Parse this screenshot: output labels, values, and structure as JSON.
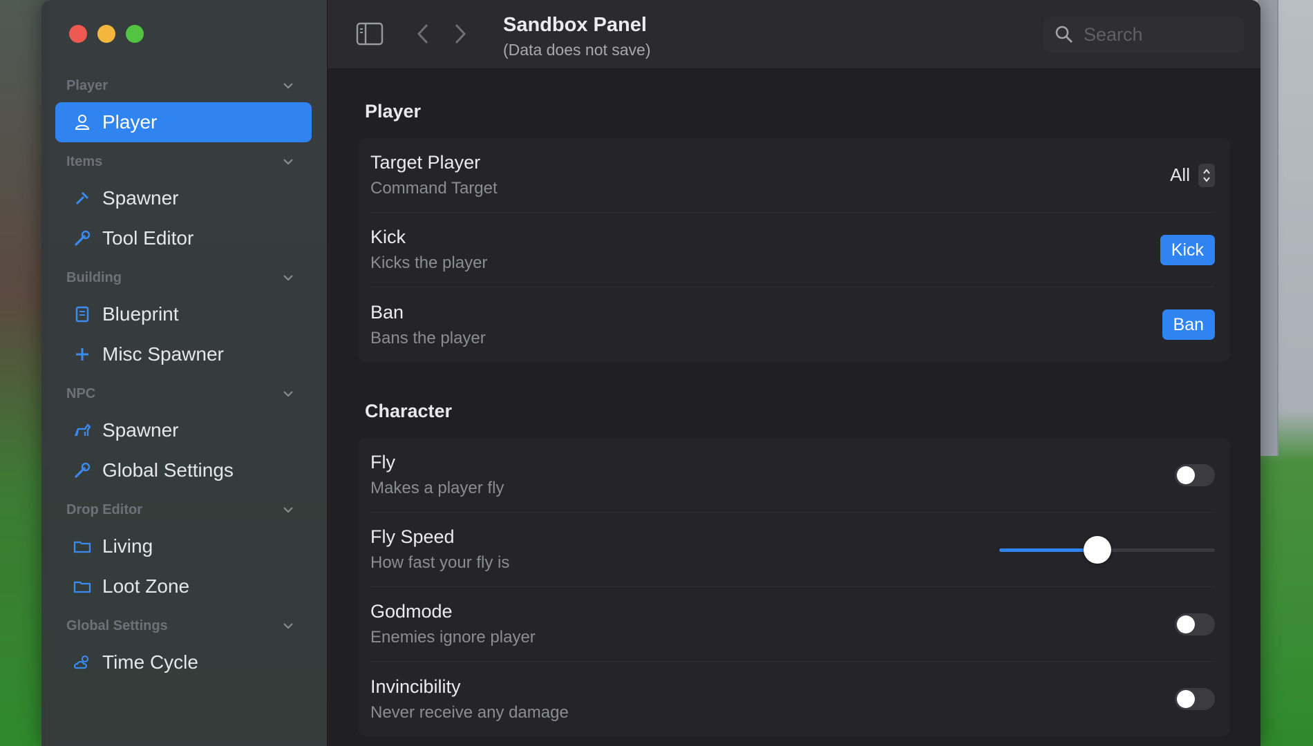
{
  "window": {
    "title": "Sandbox Panel",
    "subtitle": "(Data does not save)"
  },
  "search": {
    "placeholder": "Search"
  },
  "sidebar": {
    "sections": [
      {
        "title": "Player",
        "items": [
          {
            "label": "Player",
            "icon": "person-icon",
            "active": true
          }
        ]
      },
      {
        "title": "Items",
        "items": [
          {
            "label": "Spawner",
            "icon": "tools-icon"
          },
          {
            "label": "Tool Editor",
            "icon": "wrench-icon"
          }
        ]
      },
      {
        "title": "Building",
        "items": [
          {
            "label": "Blueprint",
            "icon": "blueprint-icon"
          },
          {
            "label": "Misc Spawner",
            "icon": "plus-icon"
          }
        ]
      },
      {
        "title": "NPC",
        "items": [
          {
            "label": "Spawner",
            "icon": "dog-icon"
          },
          {
            "label": "Global Settings",
            "icon": "wrench-icon"
          }
        ]
      },
      {
        "title": "Drop Editor",
        "items": [
          {
            "label": "Living",
            "icon": "folder-icon"
          },
          {
            "label": "Loot Zone",
            "icon": "folder-icon"
          }
        ]
      },
      {
        "title": "Global Settings",
        "items": [
          {
            "label": "Time Cycle",
            "icon": "cloud-sun-icon"
          }
        ]
      }
    ]
  },
  "main": {
    "groups": [
      {
        "title": "Player",
        "rows": [
          {
            "label": "Target Player",
            "desc": "Command Target",
            "control": "stepper",
            "value": "All"
          },
          {
            "label": "Kick",
            "desc": "Kicks the player",
            "control": "button",
            "button_label": "Kick"
          },
          {
            "label": "Ban",
            "desc": "Bans the player",
            "control": "button",
            "button_label": "Ban"
          }
        ]
      },
      {
        "title": "Character",
        "rows": [
          {
            "label": "Fly",
            "desc": "Makes a player fly",
            "control": "toggle",
            "on": false
          },
          {
            "label": "Fly Speed",
            "desc": "How fast your fly is",
            "control": "slider",
            "value_fraction": 0.45
          },
          {
            "label": "Godmode",
            "desc": "Enemies ignore player",
            "control": "toggle",
            "on": false
          },
          {
            "label": "Invincibility",
            "desc": "Never receive any damage",
            "control": "toggle",
            "on": false
          }
        ]
      }
    ]
  },
  "colors": {
    "accent": "#2f84f2",
    "sidebar_bg": "#34383c",
    "content_bg": "#202024",
    "traffic_red": "#ee5a52",
    "traffic_yellow": "#f3b73d",
    "traffic_green": "#52c441"
  }
}
